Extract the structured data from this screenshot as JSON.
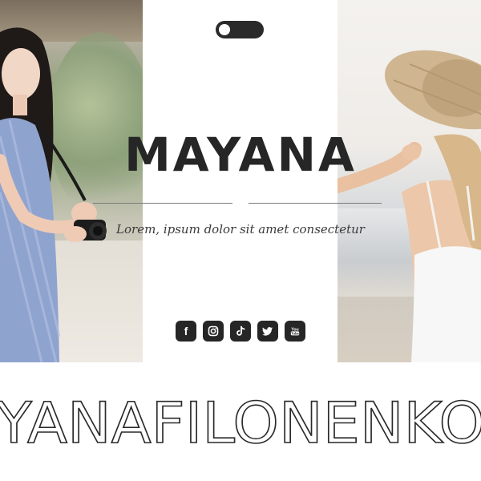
{
  "brand": {
    "title": "MAYANA",
    "tagline": "Lorem, ipsum dolor sit amet consectetur",
    "wordmark": "YANAFILONENKO"
  },
  "theme_toggle": {
    "state": "off"
  },
  "socials": [
    {
      "icon": "facebook-icon",
      "glyph": "f"
    },
    {
      "icon": "instagram-icon"
    },
    {
      "icon": "tiktok-icon"
    },
    {
      "icon": "twitter-icon"
    },
    {
      "icon": "youtube-icon",
      "glyph": "You Tube"
    }
  ],
  "photos": {
    "left": "woman-with-camera-photo",
    "right": "woman-in-straw-hat-photo"
  },
  "colors": {
    "dark": "#262626",
    "rule": "#7a7a7a",
    "background": "#ffffff"
  }
}
